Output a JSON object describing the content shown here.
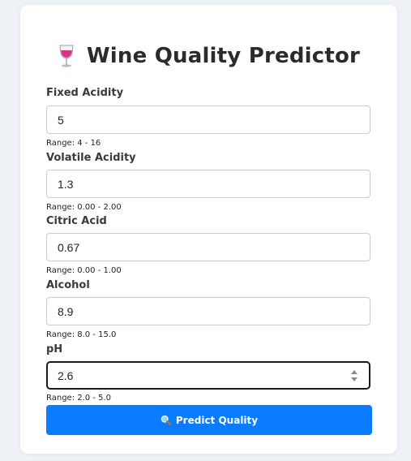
{
  "page": {
    "title": "Wine Quality Predictor",
    "title_icon": "wine-glass-icon"
  },
  "fields": [
    {
      "label": "Fixed Acidity",
      "value": "5",
      "range": "Range: 4 - 16"
    },
    {
      "label": "Volatile Acidity",
      "value": "1.3",
      "range": "Range: 0.00 - 2.00"
    },
    {
      "label": "Citric Acid",
      "value": "0.67",
      "range": "Range: 0.00 - 1.00"
    },
    {
      "label": "Alcohol",
      "value": "8.9",
      "range": "Range: 8.0 - 15.0"
    },
    {
      "label": "pH",
      "value": "2.6",
      "range": "Range: 2.0 - 5.0"
    }
  ],
  "predict_button": {
    "label": "Predict Quality",
    "icon": "magnifier-icon"
  },
  "colors": {
    "accent": "#0b7bff",
    "background": "#eef1f5",
    "card": "#ffffff"
  }
}
